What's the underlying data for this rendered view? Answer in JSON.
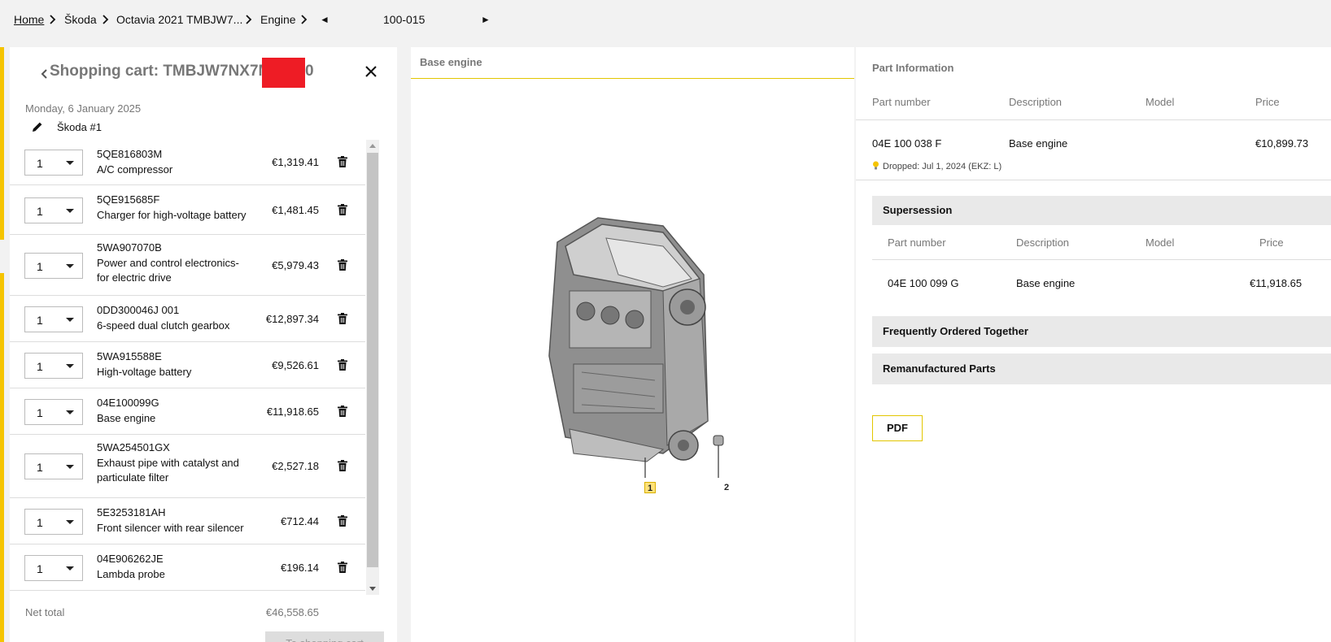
{
  "breadcrumb": {
    "home": "Home",
    "brand": "Škoda",
    "vehicle": "Octavia 2021 TMBJW7...",
    "group": "Engine",
    "page": "100-015"
  },
  "cart": {
    "title": "Shopping cart: TMBJW7NX7MY",
    "title_tail": "0",
    "date": "Monday, 6 January 2025",
    "name": "Škoda #1",
    "items": [
      {
        "qty": "1",
        "number": "5QE816803M",
        "desc": "A/C compressor",
        "price": "€1,319.41"
      },
      {
        "qty": "1",
        "number": "5QE915685F",
        "desc": "Charger for high-voltage battery",
        "price": "€1,481.45"
      },
      {
        "qty": "1",
        "number": "5WA907070B",
        "desc": "Power and control electronics-for electric drive",
        "price": "€5,979.43"
      },
      {
        "qty": "1",
        "number": "0DD300046J 001",
        "desc": "6-speed dual clutch gearbox",
        "price": "€12,897.34"
      },
      {
        "qty": "1",
        "number": "5WA915588E",
        "desc": "High-voltage battery",
        "price": "€9,526.61"
      },
      {
        "qty": "1",
        "number": "04E100099G",
        "desc": "Base engine",
        "price": "€11,918.65"
      },
      {
        "qty": "1",
        "number": "5WA254501GX",
        "desc": "Exhaust pipe with catalyst and particulate filter",
        "price": "€2,527.18"
      },
      {
        "qty": "1",
        "number": "5E3253181AH",
        "desc": "Front silencer with rear silencer",
        "price": "€712.44"
      },
      {
        "qty": "1",
        "number": "04E906262JE",
        "desc": "Lambda probe",
        "price": "€196.14"
      }
    ],
    "net_total_label": "Net total",
    "net_total_value": "€46,558.65",
    "checkout_label": "To shopping cart"
  },
  "viewer": {
    "title": "Base engine",
    "callouts": [
      "1",
      "2"
    ]
  },
  "info": {
    "title": "Part Information",
    "columns": [
      "Part number",
      "Description",
      "Model",
      "Price"
    ],
    "part": {
      "number": "04E 100 038 F",
      "desc": "Base engine",
      "model": "",
      "price": "€10,899.73"
    },
    "dropped": "Dropped: Jul 1, 2024 (EKZ: L)",
    "supersession": {
      "title": "Supersession",
      "columns": [
        "Part number",
        "Description",
        "Model",
        "Price"
      ],
      "row": {
        "number": "04E 100 099 G",
        "desc": "Base engine",
        "model": "",
        "price": "€11,918.65"
      }
    },
    "frequently_ordered": "Frequently Ordered Together",
    "remanufactured": "Remanufactured Parts",
    "pdf_label": "PDF"
  },
  "colors": {
    "accent": "#f5c400",
    "redaction": "#ee1c25",
    "section_bg": "#e9e9e9"
  }
}
